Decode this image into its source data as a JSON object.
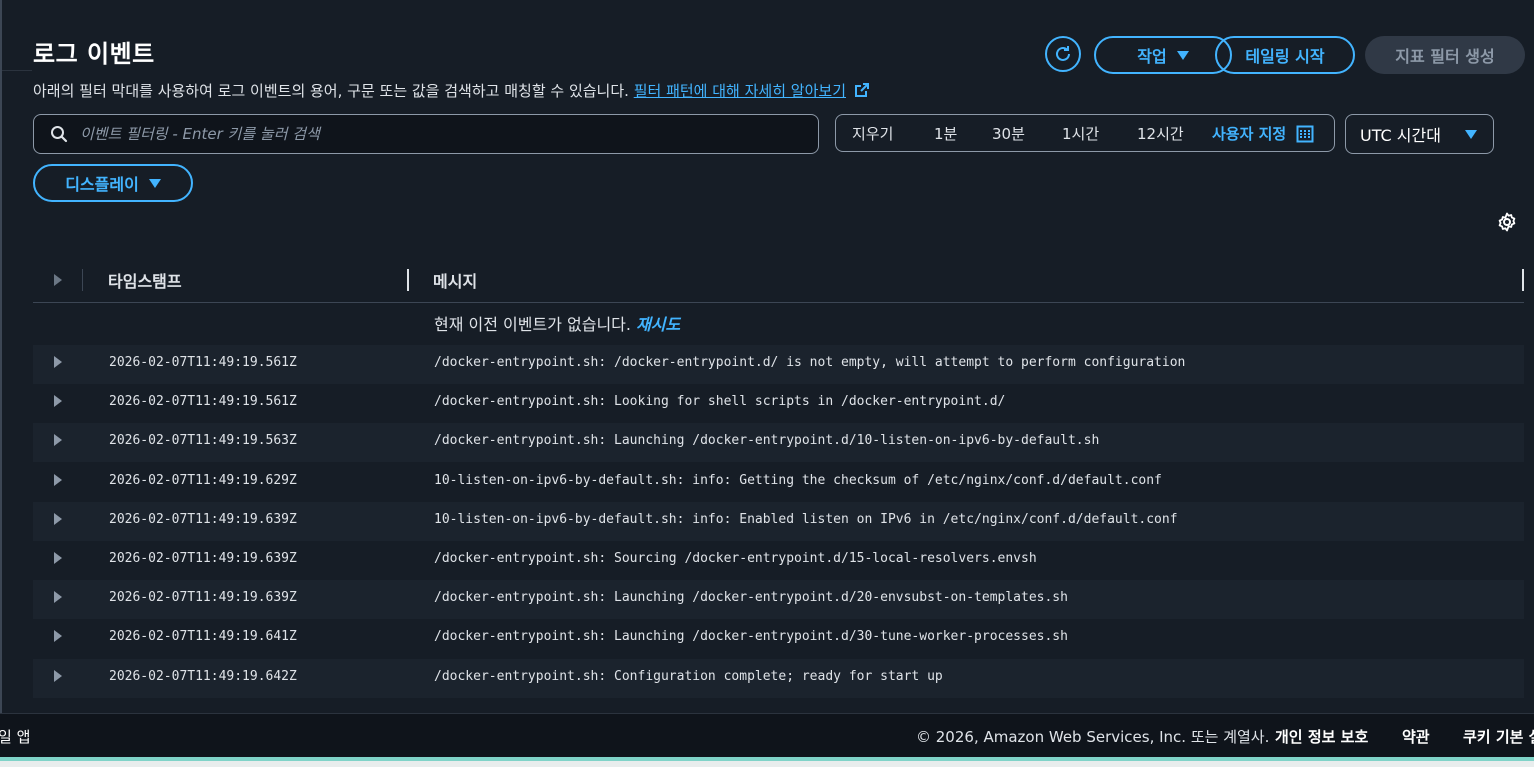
{
  "header": {
    "title": "로그 이벤트",
    "description": "아래의 필터 막대를 사용하여 로그 이벤트의 용어, 구문 또는 값을 검색하고 매칭할 수 있습니다.",
    "learn_more_link": "필터 패턴에 대해 자세히 알아보기"
  },
  "toolbar": {
    "refresh_icon": "refresh-icon",
    "actions_label": "작업",
    "tailing_label": "테일링 시작",
    "metric_filter_label": "지표 필터 생성"
  },
  "filter": {
    "placeholder": "이벤트 필터링 - Enter 키를 눌러 검색",
    "value": ""
  },
  "time_range": {
    "clear_label": "지우기",
    "options": [
      "1분",
      "30분",
      "1시간",
      "12시간"
    ],
    "custom_label": "사용자 지정"
  },
  "timezone": {
    "selected": "UTC 시간대"
  },
  "display": {
    "label": "디스플레이"
  },
  "table": {
    "columns": {
      "timestamp": "타임스탬프",
      "message": "메시지"
    },
    "no_previous": "현재 이전 이벤트가 없습니다.",
    "retry_label": "재시도",
    "rows": [
      {
        "timestamp": "2026-02-07T11:49:19.561Z",
        "message": "/docker-entrypoint.sh: /docker-entrypoint.d/ is not empty, will attempt to perform configuration"
      },
      {
        "timestamp": "2026-02-07T11:49:19.561Z",
        "message": "/docker-entrypoint.sh: Looking for shell scripts in /docker-entrypoint.d/"
      },
      {
        "timestamp": "2026-02-07T11:49:19.563Z",
        "message": "/docker-entrypoint.sh: Launching /docker-entrypoint.d/10-listen-on-ipv6-by-default.sh"
      },
      {
        "timestamp": "2026-02-07T11:49:19.629Z",
        "message": "10-listen-on-ipv6-by-default.sh: info: Getting the checksum of /etc/nginx/conf.d/default.conf"
      },
      {
        "timestamp": "2026-02-07T11:49:19.639Z",
        "message": "10-listen-on-ipv6-by-default.sh: info: Enabled listen on IPv6 in /etc/nginx/conf.d/default.conf"
      },
      {
        "timestamp": "2026-02-07T11:49:19.639Z",
        "message": "/docker-entrypoint.sh: Sourcing /docker-entrypoint.d/15-local-resolvers.envsh"
      },
      {
        "timestamp": "2026-02-07T11:49:19.639Z",
        "message": "/docker-entrypoint.sh: Launching /docker-entrypoint.d/20-envsubst-on-templates.sh"
      },
      {
        "timestamp": "2026-02-07T11:49:19.641Z",
        "message": "/docker-entrypoint.sh: Launching /docker-entrypoint.d/30-tune-worker-processes.sh"
      },
      {
        "timestamp": "2026-02-07T11:49:19.642Z",
        "message": "/docker-entrypoint.sh: Configuration complete; ready for start up"
      }
    ]
  },
  "footer": {
    "left_text": "일 앱",
    "copyright": "© 2026, Amazon Web Services, Inc. 또는 계열사.",
    "privacy": "개인 정보 보호",
    "terms": "약관",
    "cookies": "쿠키 기본 설"
  },
  "colors": {
    "accent": "#42b4ff",
    "background": "#161d26",
    "row_stripe": "#1b232d"
  }
}
